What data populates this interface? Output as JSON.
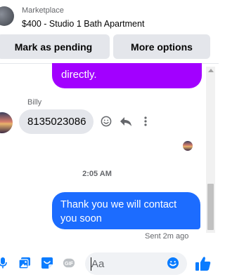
{
  "header": {
    "marketplace_label": "Marketplace",
    "listing_title": "$400 - Studio 1 Bath Apartment",
    "mark_pending_label": "Mark as pending",
    "more_options_label": "More options"
  },
  "messages": {
    "outgoing_previous_text": "directly.",
    "incoming_sender": "Billy",
    "incoming_text": "8135023086",
    "timestamp": "2:05 AM",
    "outgoing_text": "Thank you we will contact you soon",
    "sent_status": "Sent 2m ago"
  },
  "composer": {
    "placeholder": "Aa",
    "gif_label": "GIF"
  },
  "colors": {
    "accent_blue": "#1c6cff",
    "purple_bubble": "#a200ff",
    "gray_bubble": "#e4e6eb",
    "icon_blue": "#0a7cff"
  },
  "icons": {
    "microphone": "microphone-icon",
    "photo": "photo-icon",
    "sticker": "sticker-icon",
    "gif": "gif-icon",
    "emoji": "emoji-icon",
    "like": "thumbs-up-icon",
    "reply": "reply-icon",
    "more": "more-vertical-icon"
  }
}
